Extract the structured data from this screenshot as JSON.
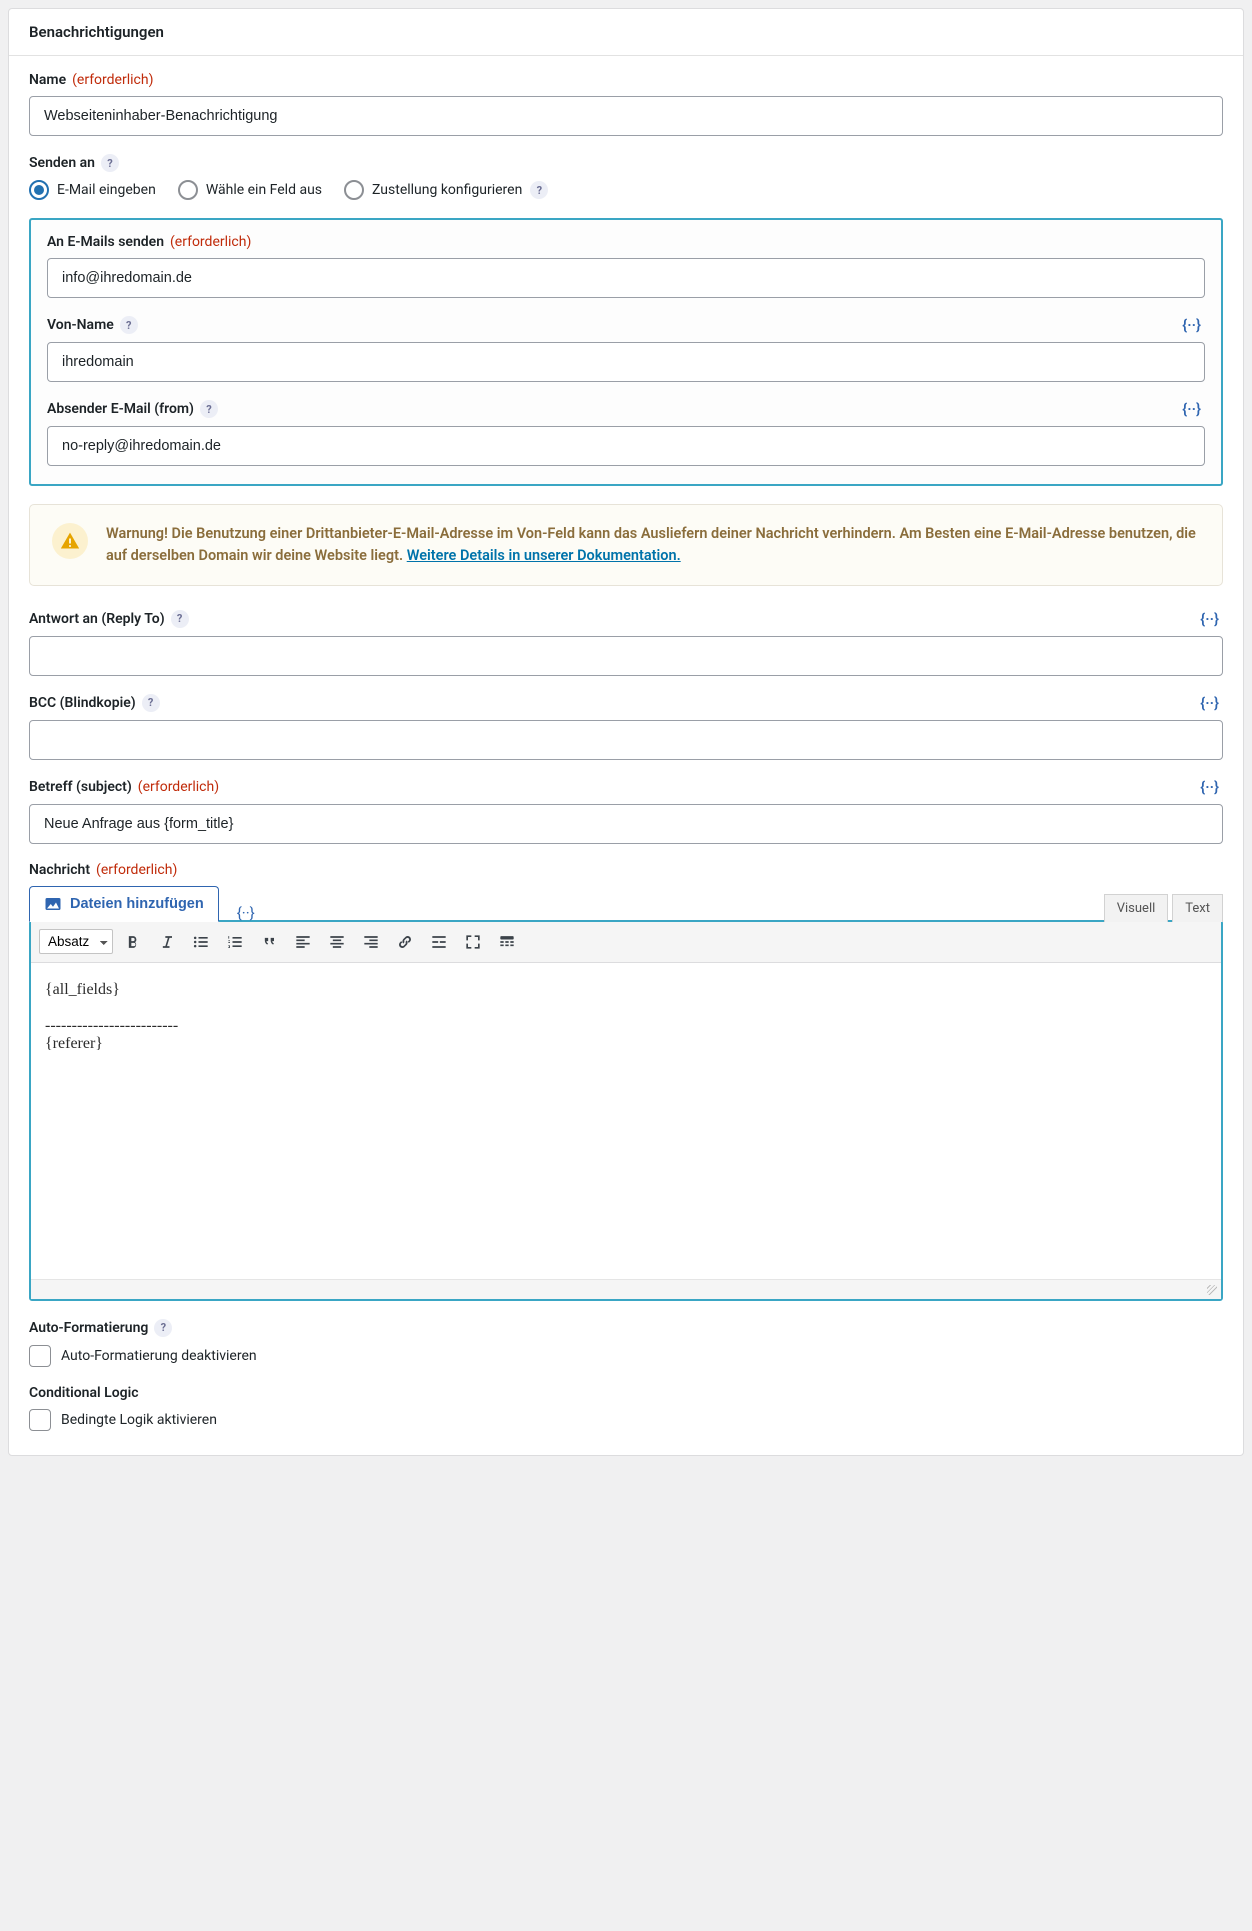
{
  "header": "Benachrichtigungen",
  "labels": {
    "name": "Name",
    "required": "(erforderlich)",
    "send_to": "Senden an",
    "to_emails": "An E-Mails senden",
    "from_name": "Von-Name",
    "from_email": "Absender E-Mail (from)",
    "reply_to": "Antwort an (Reply To)",
    "bcc": "BCC (Blindkopie)",
    "subject": "Betreff (subject)",
    "message": "Nachricht",
    "auto_format": "Auto-Formatierung",
    "conditional": "Conditional Logic"
  },
  "values": {
    "name": "Webseiteninhaber-Benachrichtigung",
    "to_emails": "info@ihredomain.de",
    "from_name": "ihredomain",
    "from_email": "no-reply@ihredomain.de",
    "reply_to": "",
    "bcc": "",
    "subject": "Neue Anfrage aus {form_title}",
    "message": "{all_fields}\n\n-------------------------\n{referer}"
  },
  "radio": {
    "enter_email": "E-Mail eingeben",
    "select_field": "Wähle ein Feld aus",
    "configure_routing": "Zustellung konfigurieren"
  },
  "notice": {
    "text": "Warnung! Die Benutzung einer Drittanbieter-E-Mail-Adresse im Von-Feld kann das Ausliefern deiner Nachricht verhindern. Am Besten eine E-Mail-Adresse benutzen, die auf derselben Domain wir deine Website liegt. ",
    "link": "Weitere Details in unserer Dokumentation."
  },
  "editor": {
    "add_files": "Dateien hinzufügen",
    "tab_visual": "Visuell",
    "tab_text": "Text",
    "format_select": "Absatz"
  },
  "checkboxes": {
    "auto_format": "Auto-Formatierung deaktivieren",
    "conditional": "Bedingte Logik aktivieren"
  }
}
